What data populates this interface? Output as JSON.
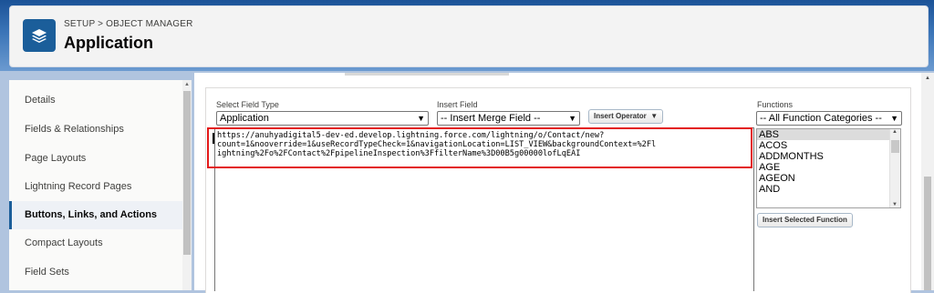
{
  "header": {
    "breadcrumb": "SETUP > OBJECT MANAGER",
    "title": "Application",
    "icon": "layers-icon",
    "band_color": "#1b5297",
    "icon_color": "#1b5e9a"
  },
  "sidebar": {
    "items": [
      {
        "label": "Details",
        "active": false
      },
      {
        "label": "Fields & Relationships",
        "active": false
      },
      {
        "label": "Page Layouts",
        "active": false
      },
      {
        "label": "Lightning Record Pages",
        "active": false
      },
      {
        "label": "Buttons, Links, and Actions",
        "active": true
      },
      {
        "label": "Compact Layouts",
        "active": false
      },
      {
        "label": "Field Sets",
        "active": false
      }
    ]
  },
  "editor": {
    "field_type_label": "Select Field Type",
    "field_type_value": "Application",
    "insert_field_label": "Insert Field",
    "insert_field_value": "-- Insert Merge Field --",
    "insert_operator_label": "Insert Operator",
    "formula_lines": [
      "https://anuhyadigital5-dev-ed.develop.lightning.force.com/lightning/o/Contact/new?",
      "count=1&nooverride=1&useRecordTypeCheck=1&navigationLocation=LIST_VIEW&backgroundContext=%2Fl",
      "ightning%2Fo%2FContact%2FpipelineInspection%3FfilterName%3D00B5g00000lofLqEAI"
    ],
    "highlight_color": "#e31818"
  },
  "functions": {
    "label": "Functions",
    "category_value": "-- All Function Categories --",
    "items": [
      "ABS",
      "ACOS",
      "ADDMONTHS",
      "AGE",
      "AGEON",
      "AND"
    ],
    "selected": "ABS",
    "insert_button": "Insert Selected Function"
  }
}
